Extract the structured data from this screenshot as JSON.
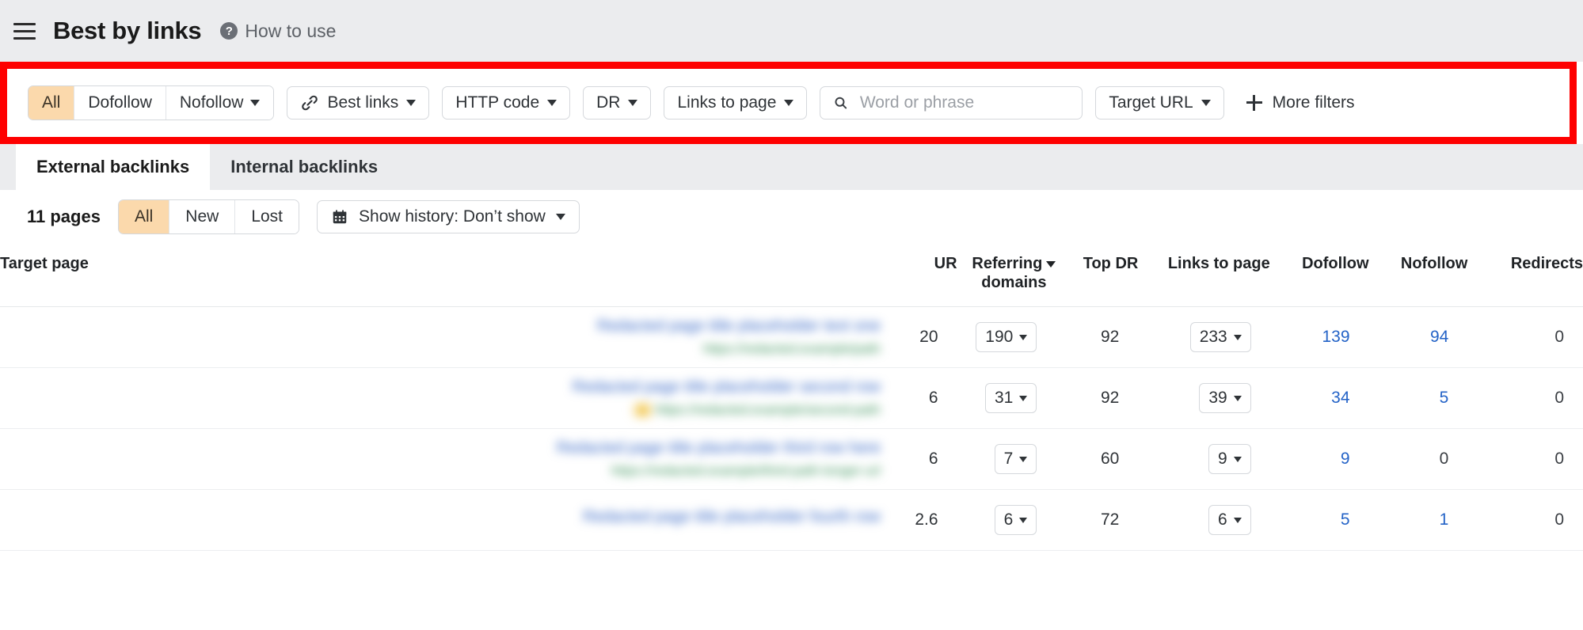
{
  "header": {
    "menu_icon": "hamburger-menu-icon",
    "title": "Best by links",
    "help_icon": "?",
    "how_to_use": "How to use"
  },
  "filter_bar": {
    "follow_segment": [
      {
        "label": "All",
        "active": true,
        "caret": false
      },
      {
        "label": "Dofollow",
        "active": false,
        "caret": false
      },
      {
        "label": "Nofollow",
        "active": false,
        "caret": true
      }
    ],
    "best_links": {
      "label": "Best links",
      "icon": "link-chain-icon"
    },
    "http_code": {
      "label": "HTTP code"
    },
    "dr": {
      "label": "DR"
    },
    "links_to_page": {
      "label": "Links to page"
    },
    "search": {
      "placeholder": "Word or phrase",
      "value": "",
      "icon": "search-icon"
    },
    "target_url": {
      "label": "Target URL"
    },
    "more_filters": {
      "label": "More filters",
      "icon": "plus-icon"
    },
    "highlight_color": "#fe0000"
  },
  "tabs": [
    {
      "label": "External backlinks",
      "active": true
    },
    {
      "label": "Internal backlinks",
      "active": false
    }
  ],
  "sub_toolbar": {
    "pages_count": "11 pages",
    "status_segment": [
      {
        "label": "All",
        "active": true
      },
      {
        "label": "New",
        "active": false
      },
      {
        "label": "Lost",
        "active": false
      }
    ],
    "history": {
      "label": "Show history: Don’t show",
      "icon": "calendar-icon"
    }
  },
  "table": {
    "columns": [
      {
        "key": "target",
        "label": "Target page",
        "sorted": false
      },
      {
        "key": "ur",
        "label": "UR",
        "sorted": false
      },
      {
        "key": "referring_domains",
        "label": "Referring domains",
        "sorted": true
      },
      {
        "key": "top_dr",
        "label": "Top DR",
        "sorted": false
      },
      {
        "key": "links_to_page",
        "label": "Links to page",
        "sorted": false
      },
      {
        "key": "dofollow",
        "label": "Dofollow",
        "sorted": false
      },
      {
        "key": "nofollow",
        "label": "Nofollow",
        "sorted": false
      },
      {
        "key": "redirects",
        "label": "Redirects",
        "sorted": false
      }
    ],
    "rows": [
      {
        "target_title": "Redacted page title placeholder text one",
        "target_url": "https://redacted.example/path",
        "favicon": false,
        "ur": "20",
        "referring_domains": "190",
        "top_dr": "92",
        "links_to_page": "233",
        "dofollow": "139",
        "nofollow": "94",
        "redirects": "0"
      },
      {
        "target_title": "Redacted page title placeholder second row",
        "target_url": "https://redacted.example/second-path",
        "favicon": true,
        "ur": "6",
        "referring_domains": "31",
        "top_dr": "92",
        "links_to_page": "39",
        "dofollow": "34",
        "nofollow": "5",
        "redirects": "0"
      },
      {
        "target_title": "Redacted page title placeholder third row here",
        "target_url": "https://redacted.example/third-path-longer-url",
        "favicon": false,
        "ur": "6",
        "referring_domains": "7",
        "top_dr": "60",
        "links_to_page": "9",
        "dofollow": "9",
        "nofollow": "0",
        "redirects": "0"
      },
      {
        "target_title": "Redacted page title placeholder fourth row",
        "target_url": "https://redacted.example/fourth",
        "favicon": false,
        "ur": "2.6",
        "referring_domains": "6",
        "top_dr": "72",
        "links_to_page": "6",
        "dofollow": "5",
        "nofollow": "1",
        "redirects": "0"
      }
    ]
  }
}
